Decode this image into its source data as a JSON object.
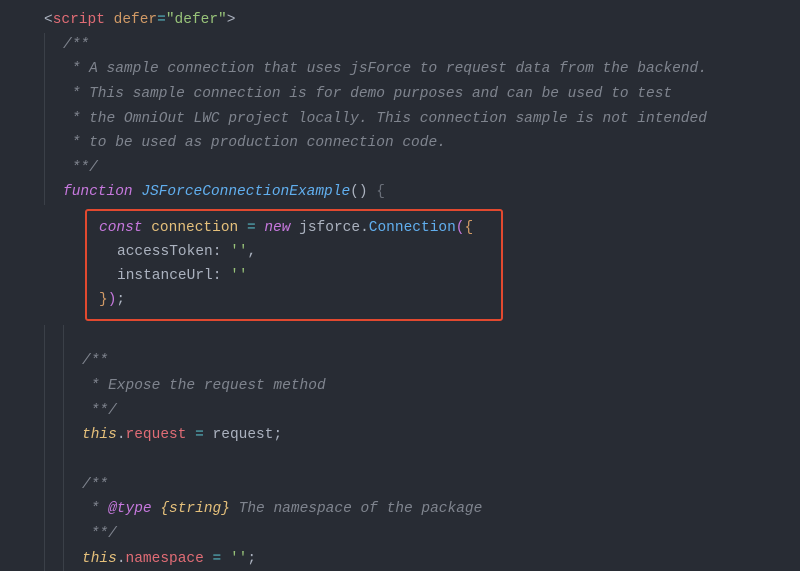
{
  "code": {
    "scriptTagOpen": {
      "lt": "<",
      "tag": "script",
      "sp": " ",
      "attr": "defer",
      "eq": "=",
      "val": "\"defer\"",
      "gt": ">"
    },
    "doc1": [
      "/**",
      " * A sample connection that uses jsForce to request data from the backend.",
      " * This sample connection is for demo purposes and can be used to test",
      " * the OmniOut LWC project locally. This connection sample is not intended",
      " * to be used as production connection code.",
      " **/"
    ],
    "fnDecl": {
      "kw": "function",
      "sp": " ",
      "name": "JSForceConnectionExample",
      "paren": "() ",
      "brace": "{"
    },
    "connBlock": {
      "l1": {
        "kw": "const",
        "sp1": " ",
        "var": "connection",
        "sp2": " ",
        "eq": "=",
        "sp3": " ",
        "new": "new",
        "sp4": " ",
        "obj": "jsforce",
        "dot": ".",
        "ctor": "Connection",
        "po": "(",
        "bo": "{"
      },
      "l2": {
        "prop": "accessToken",
        "colon": ":",
        "sp": " ",
        "val": "''",
        "comma": ","
      },
      "l3": {
        "prop": "instanceUrl",
        "colon": ":",
        "sp": " ",
        "val": "''"
      },
      "l4": {
        "bc": "}",
        "pc": ")",
        "semi": ";"
      }
    },
    "doc2": [
      "/**",
      " * Expose the request method",
      " **/"
    ],
    "reqLine": {
      "this": "this",
      "dot": ".",
      "prop": "request",
      "sp1": " ",
      "eq": "=",
      "sp2": " ",
      "rhs": "request",
      "semi": ";"
    },
    "doc3": {
      "open": "/**",
      "star": " * ",
      "tag": "@type",
      "sp1": " ",
      "type": "{string}",
      "sp2": " ",
      "desc": "The namespace of the package",
      "close": " **/"
    },
    "nsLine": {
      "this": "this",
      "dot": ".",
      "prop": "namespace",
      "sp1": " ",
      "eq": "=",
      "sp2": " ",
      "val": "''",
      "semi": ";"
    }
  }
}
